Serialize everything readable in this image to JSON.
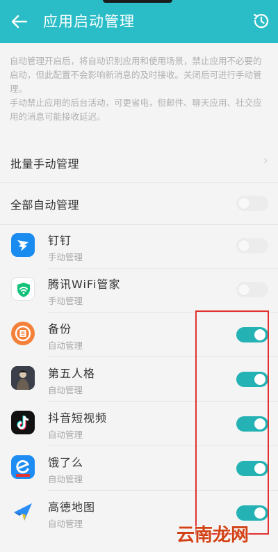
{
  "header": {
    "title": "应用启动管理",
    "back_icon": "arrow-left-icon",
    "history_icon": "history-clock-icon",
    "color": "#2bbdc7"
  },
  "description": {
    "paragraph1": "自动管理开启后，将自动识别应用和使用场景，禁止应用不必要的启动，但此配置不会影响新消息的及时接收。关闭后可进行手动管理。",
    "paragraph2": "手动禁止应用的后台活动，可更省电，但邮件、聊天应用、社交应用的消息可能接收延迟。"
  },
  "batch_manual": {
    "label": "批量手动管理",
    "chevron": "›"
  },
  "auto_all": {
    "label": "全部自动管理",
    "enabled": false
  },
  "apps": [
    {
      "name": "钉钉",
      "status": "手动管理",
      "enabled": false,
      "icon": "dingtalk-icon"
    },
    {
      "name": "腾讯WiFi管家",
      "status": "手动管理",
      "enabled": false,
      "icon": "tencent-wifi-icon"
    },
    {
      "name": "备份",
      "status": "自动管理",
      "enabled": true,
      "icon": "backup-icon"
    },
    {
      "name": "第五人格",
      "status": "自动管理",
      "enabled": true,
      "icon": "identity-v-icon"
    },
    {
      "name": "抖音短视频",
      "status": "自动管理",
      "enabled": true,
      "icon": "douyin-icon"
    },
    {
      "name": "饿了么",
      "status": "自动管理",
      "enabled": true,
      "icon": "eleme-icon"
    },
    {
      "name": "高德地图",
      "status": "自动管理",
      "enabled": true,
      "icon": "amap-icon"
    }
  ],
  "accent_color": "#25b2b4",
  "annotation_color": "#e23030",
  "watermark": "云南龙网"
}
